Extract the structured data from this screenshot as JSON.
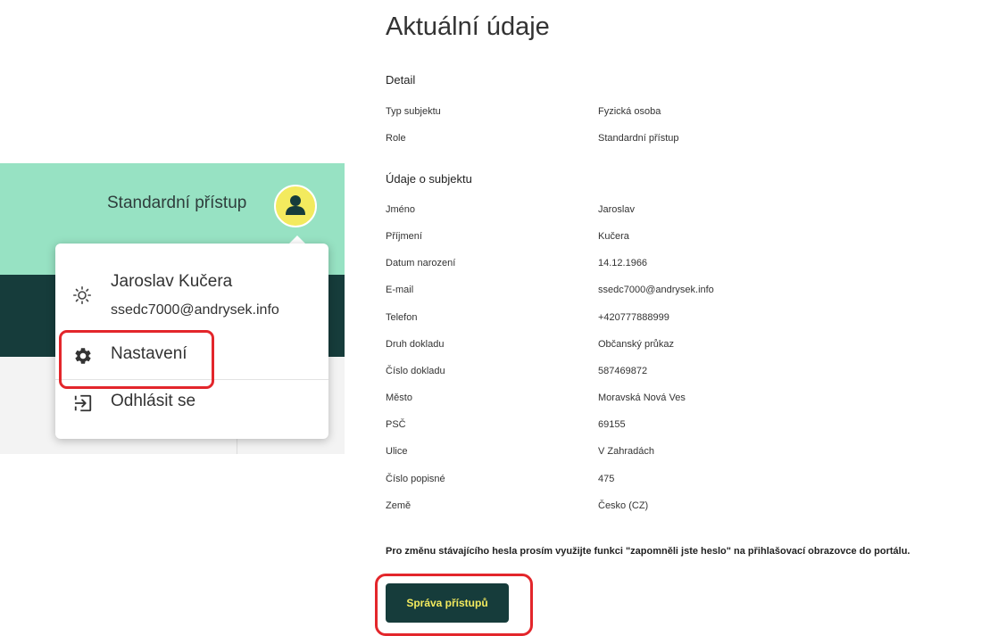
{
  "header": {
    "role_label": "Standardní přístup"
  },
  "user_menu": {
    "user_name": "Jaroslav Kučera",
    "user_email": "ssedc7000@andrysek.info",
    "items": [
      {
        "label": "Nastavení",
        "icon": "gear-icon"
      },
      {
        "label": "Odhlásit se",
        "icon": "logout-icon"
      }
    ]
  },
  "details": {
    "title": "Aktuální údaje",
    "detail_section": {
      "heading": "Detail",
      "rows": [
        {
          "label": "Typ subjektu",
          "value": "Fyzická osoba"
        },
        {
          "label": "Role",
          "value": "Standardní přístup"
        }
      ]
    },
    "subject_section": {
      "heading": "Údaje o subjektu",
      "rows": [
        {
          "label": "Jméno",
          "value": "Jaroslav"
        },
        {
          "label": "Příjmení",
          "value": "Kučera"
        },
        {
          "label": "Datum narození",
          "value": "14.12.1966"
        },
        {
          "label": "E-mail",
          "value": "ssedc7000@andrysek.info"
        },
        {
          "label": "Telefon",
          "value": "+420777888999"
        },
        {
          "label": "Druh dokladu",
          "value": "Občanský průkaz"
        },
        {
          "label": "Číslo dokladu",
          "value": "587469872"
        },
        {
          "label": "Město",
          "value": "Moravská Nová Ves"
        },
        {
          "label": "PSČ",
          "value": "69155"
        },
        {
          "label": "Ulice",
          "value": "V Zahradách"
        },
        {
          "label": "Číslo popisné",
          "value": "475"
        },
        {
          "label": "Země",
          "value": "Česko (CZ)"
        }
      ]
    },
    "note": "Pro změnu stávajícího hesla prosím využijte funkci \"zapomněli jste heslo\" na přihlašovací obrazovce do portálu.",
    "access_button_label": "Správa přístupů"
  },
  "colors": {
    "header_bg": "#97e2c3",
    "dark_band": "#163c3b",
    "avatar_bg": "#f3ea5e",
    "highlight": "#e3262b",
    "button_text": "#f3ea5e"
  }
}
